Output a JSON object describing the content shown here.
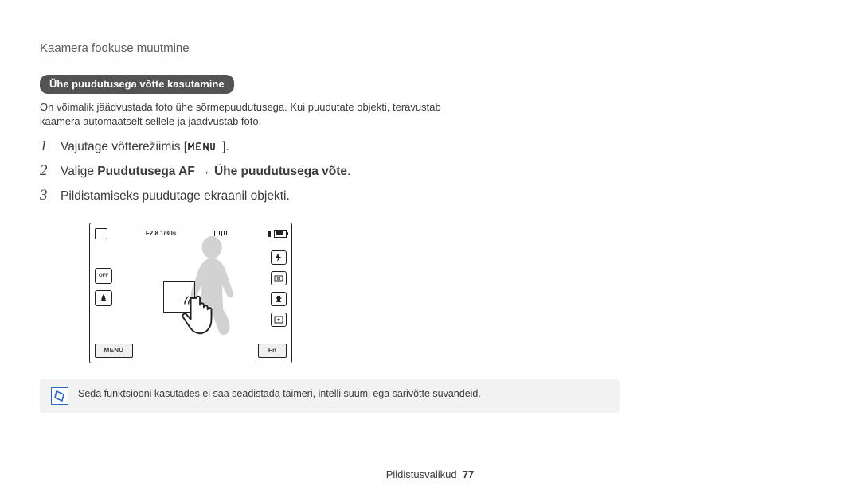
{
  "header": "Kaamera fookuse muutmine",
  "pill": "Ühe puudutusega võtte kasutamine",
  "intro": "On võimalik jäädvustada foto ühe sõrmepuudutusega. Kui puudutate objekti, teravustab kaamera automaatselt sellele ja jäädvustab foto.",
  "steps": {
    "s1_pre": "Vajutage võtterežiimis [",
    "s1_post": "].",
    "s2_pre": "Valige ",
    "s2_b1": "Puudutusega AF",
    "s2_arrow": " → ",
    "s2_b2": "Ühe puudutusega võte",
    "s2_post": ".",
    "s3": "Pildistamiseks puudutage ekraanil objekti."
  },
  "camera": {
    "exposure": "F2.8 1/30s",
    "menu": "MENU",
    "fn": "Fn",
    "off_label": "OFF"
  },
  "note": "Seda funktsiooni kasutades ei saa seadistada taimeri, intelli suumi ega sarivõtte suvandeid.",
  "footer_label": "Pildistusvalikud",
  "footer_page": "77"
}
